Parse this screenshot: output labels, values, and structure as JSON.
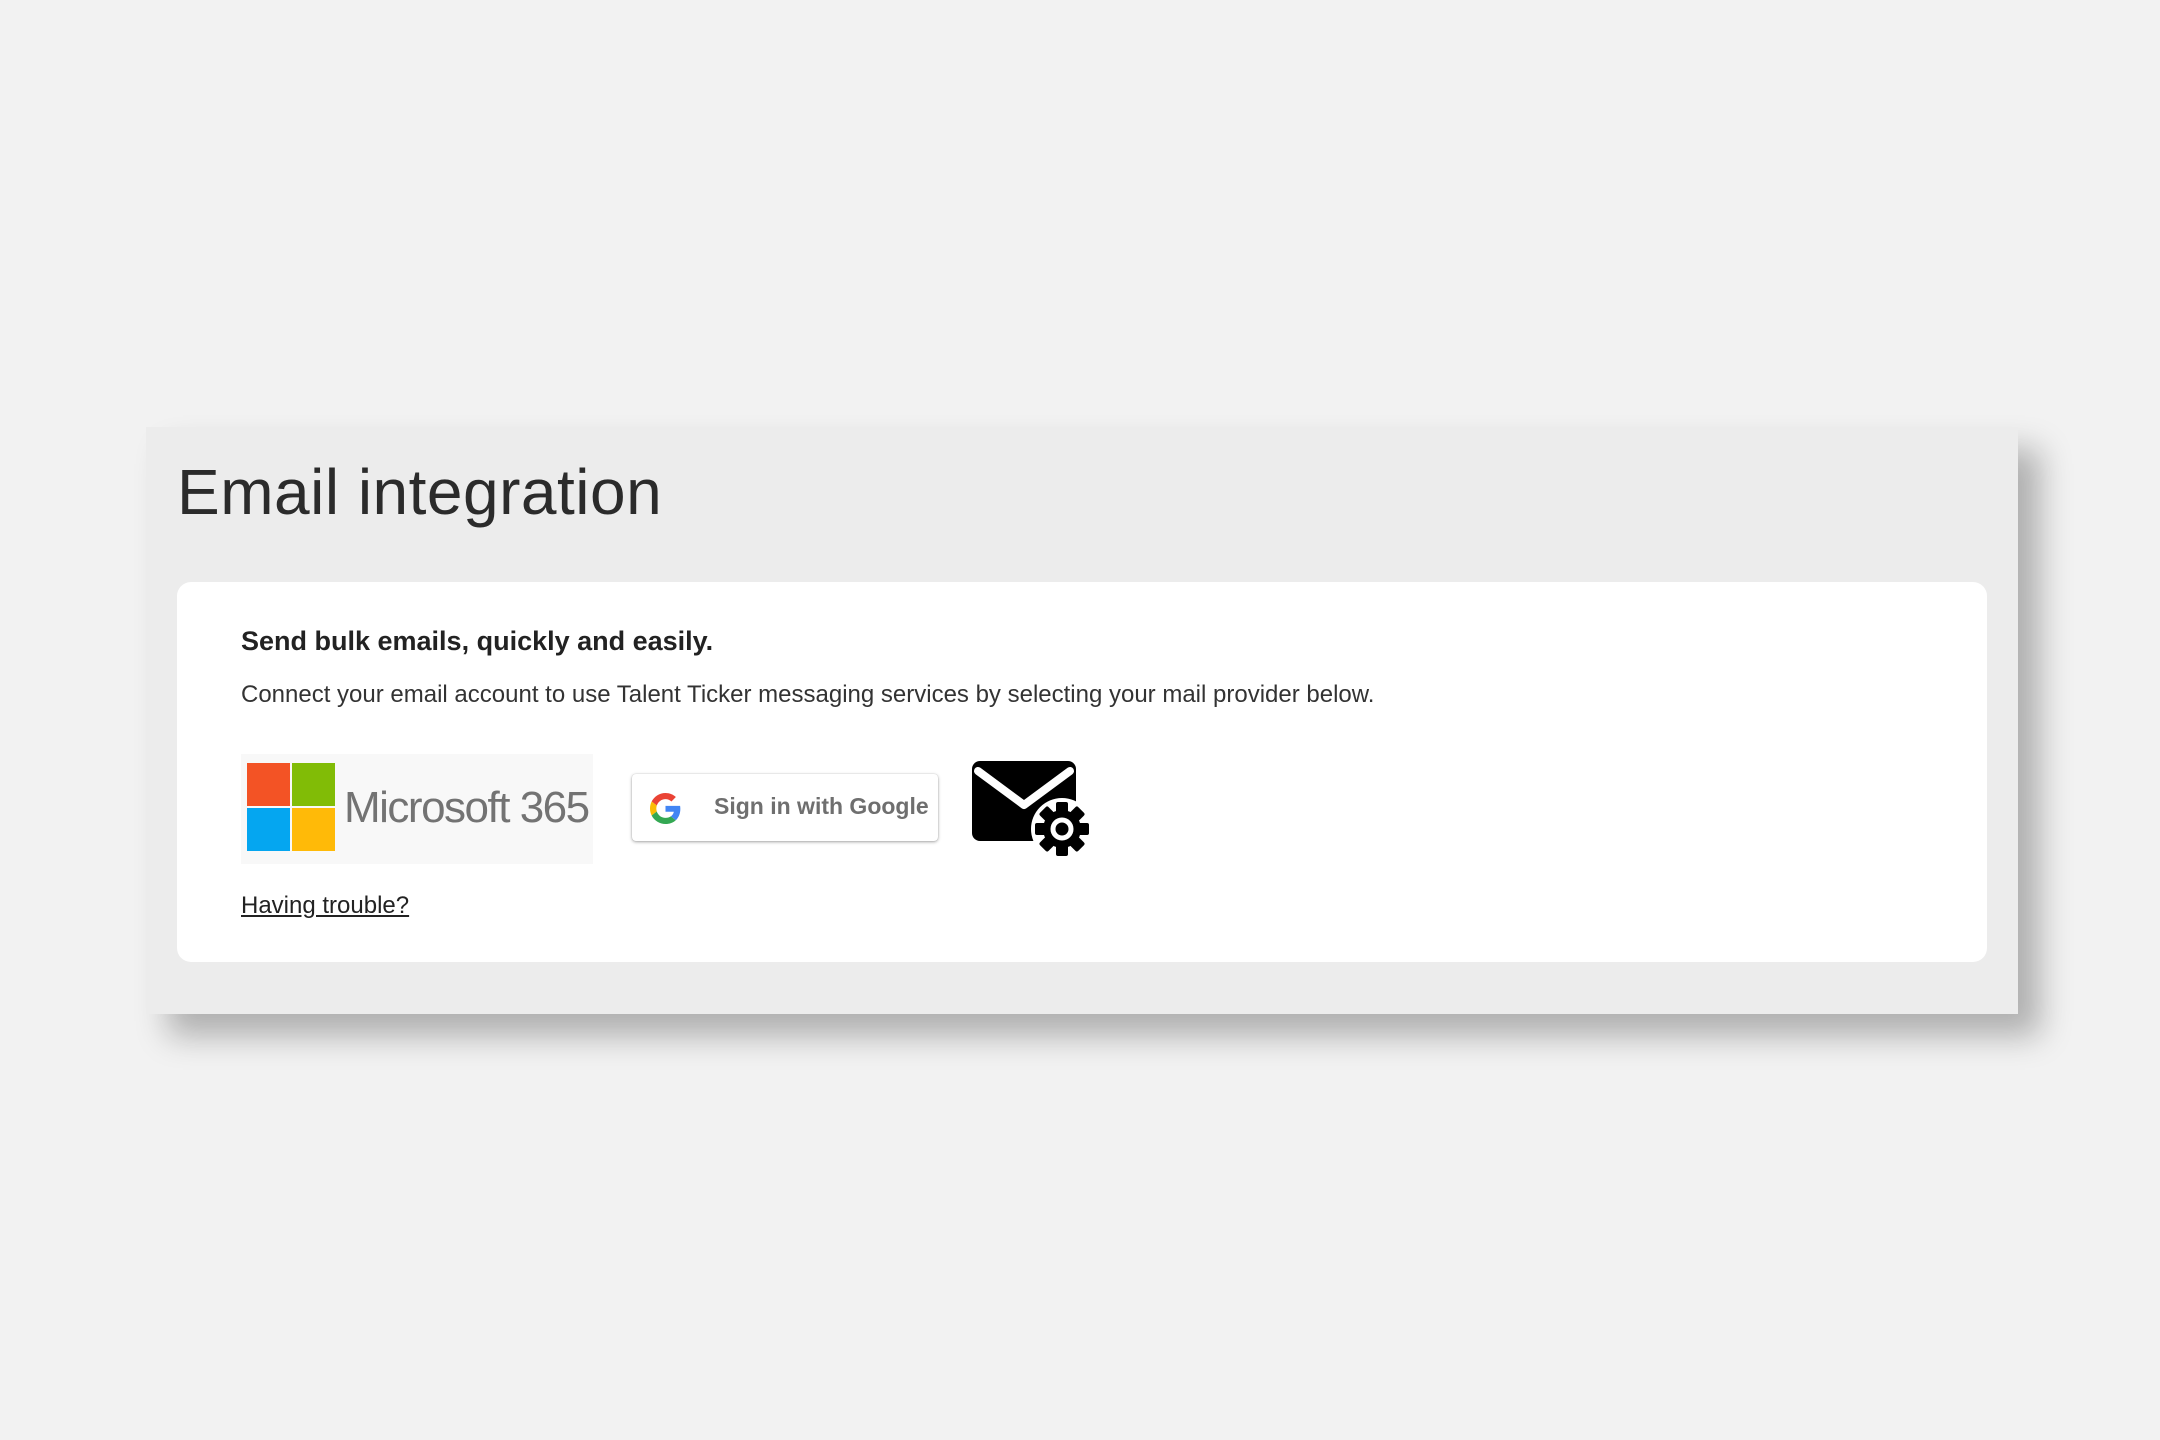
{
  "page": {
    "title": "Email integration"
  },
  "card": {
    "heading": "Send bulk emails, quickly and easily.",
    "description": "Connect your email account to use Talent Ticker messaging services by selecting your mail provider below.",
    "trouble_link": "Having trouble?"
  },
  "providers": {
    "microsoft": {
      "label": "Microsoft 365",
      "icon": "microsoft-logo-icon",
      "colors": [
        "#f35325",
        "#81bc06",
        "#05a6f0",
        "#ffba08"
      ]
    },
    "google": {
      "label": "Sign in with Google",
      "icon": "google-g-icon"
    },
    "other": {
      "icon": "mail-settings-icon"
    }
  }
}
